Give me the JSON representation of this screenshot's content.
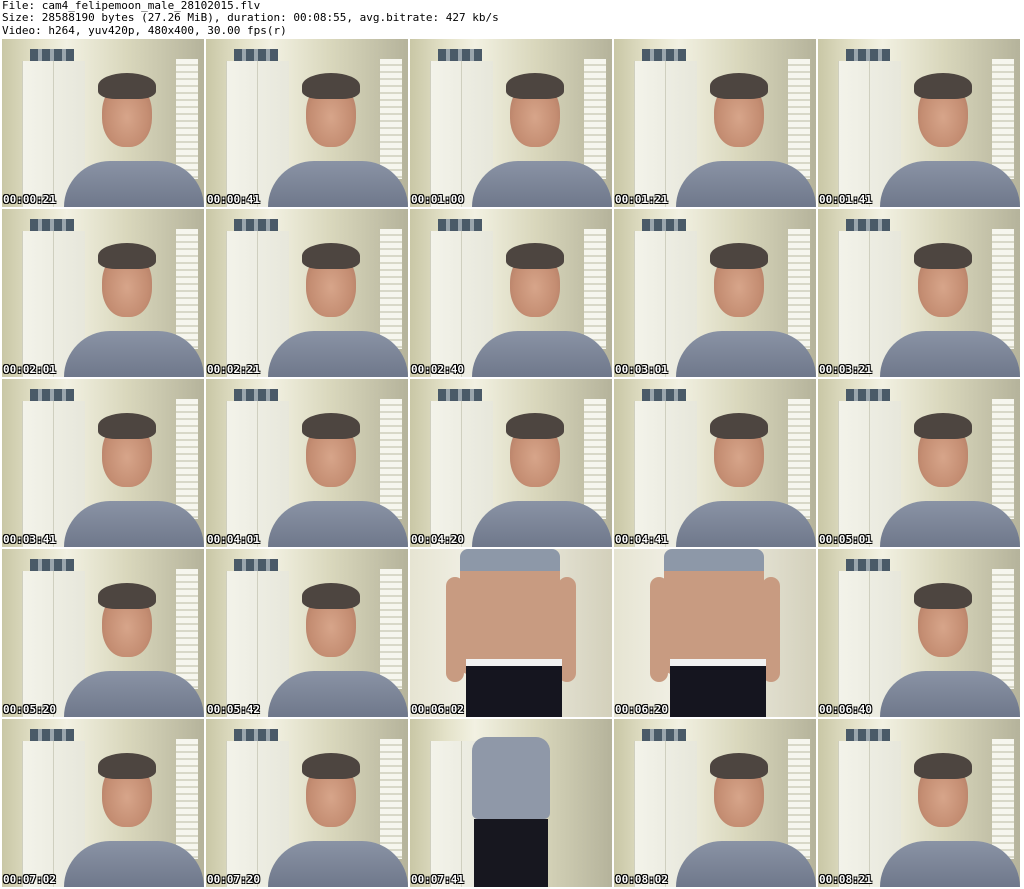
{
  "header": {
    "file_line": "File: cam4_felipemoon_male_28102015.flv",
    "size_line": "Size: 28588190 bytes (27.26 MiB), duration: 00:08:55, avg.bitrate: 427 kb/s",
    "video_line": "Video: h264, yuv420p, 480x400, 30.00 fps(r)"
  },
  "thumbnails": [
    {
      "time": "00:00:21",
      "kind": "face"
    },
    {
      "time": "00:00:41",
      "kind": "face"
    },
    {
      "time": "00:01:00",
      "kind": "face"
    },
    {
      "time": "00:01:21",
      "kind": "face"
    },
    {
      "time": "00:01:41",
      "kind": "face"
    },
    {
      "time": "00:02:01",
      "kind": "face"
    },
    {
      "time": "00:02:21",
      "kind": "face"
    },
    {
      "time": "00:02:40",
      "kind": "face"
    },
    {
      "time": "00:03:01",
      "kind": "face"
    },
    {
      "time": "00:03:21",
      "kind": "face"
    },
    {
      "time": "00:03:41",
      "kind": "face"
    },
    {
      "time": "00:04:01",
      "kind": "face"
    },
    {
      "time": "00:04:20",
      "kind": "face"
    },
    {
      "time": "00:04:41",
      "kind": "face"
    },
    {
      "time": "00:05:01",
      "kind": "face"
    },
    {
      "time": "00:05:20",
      "kind": "face"
    },
    {
      "time": "00:05:42",
      "kind": "face"
    },
    {
      "time": "00:06:02",
      "kind": "body"
    },
    {
      "time": "00:06:20",
      "kind": "body"
    },
    {
      "time": "00:06:40",
      "kind": "face"
    },
    {
      "time": "00:07:02",
      "kind": "face"
    },
    {
      "time": "00:07:20",
      "kind": "face"
    },
    {
      "time": "00:07:41",
      "kind": "stand"
    },
    {
      "time": "00:08:02",
      "kind": "face"
    },
    {
      "time": "00:08:21",
      "kind": "face"
    }
  ]
}
